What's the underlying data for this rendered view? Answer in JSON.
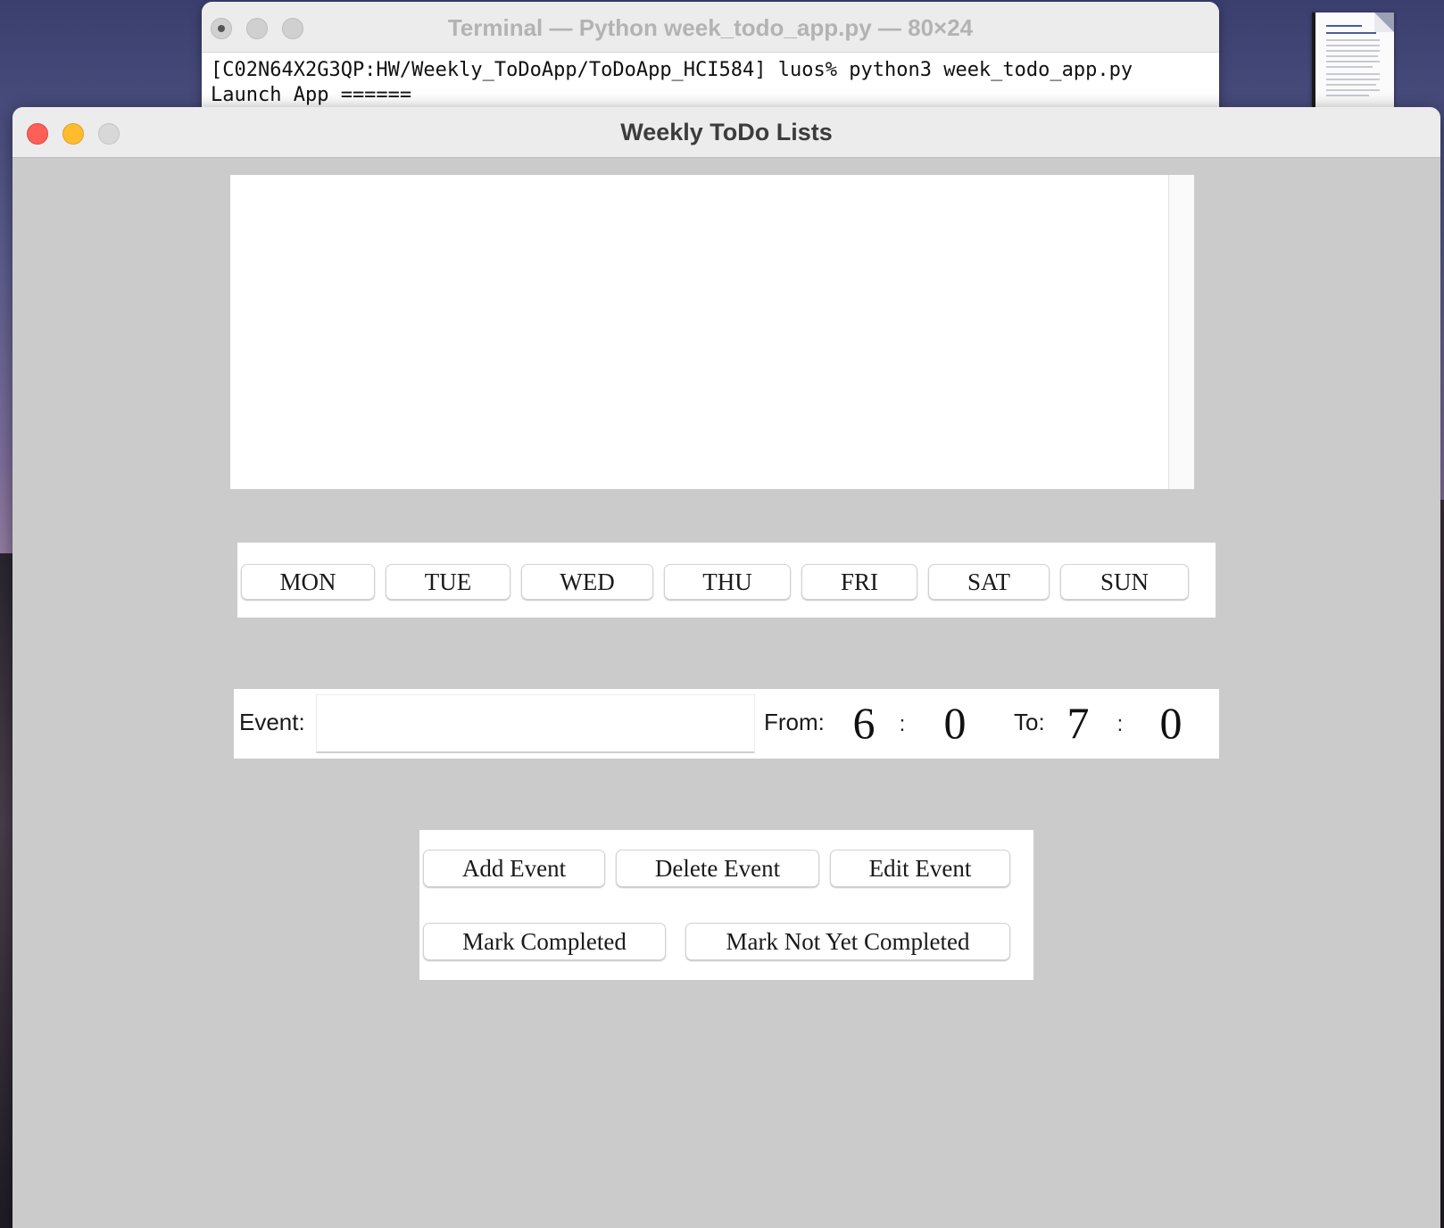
{
  "terminal": {
    "title": "Terminal — Python week_todo_app.py — 80×24",
    "line1": "[C02N64X2G3QP:HW/Weekly_ToDoApp/ToDoApp_HCI584] luos% python3 week_todo_app.py",
    "line2": "Launch App ======"
  },
  "window": {
    "title": "Weekly ToDo Lists"
  },
  "days": [
    "MON",
    "TUE",
    "WED",
    "THU",
    "FRI",
    "SAT",
    "SUN"
  ],
  "event": {
    "label": "Event:",
    "value": "",
    "from_label": "From:",
    "from_hour": "6",
    "from_minute": "0",
    "to_label": "To:",
    "to_hour": "7",
    "to_minute": "0",
    "separator": ":"
  },
  "actions": {
    "add": "Add Event",
    "delete": "Delete Event",
    "edit": "Edit Event",
    "mark_completed": "Mark Completed",
    "mark_not_completed": "Mark Not Yet Completed"
  }
}
